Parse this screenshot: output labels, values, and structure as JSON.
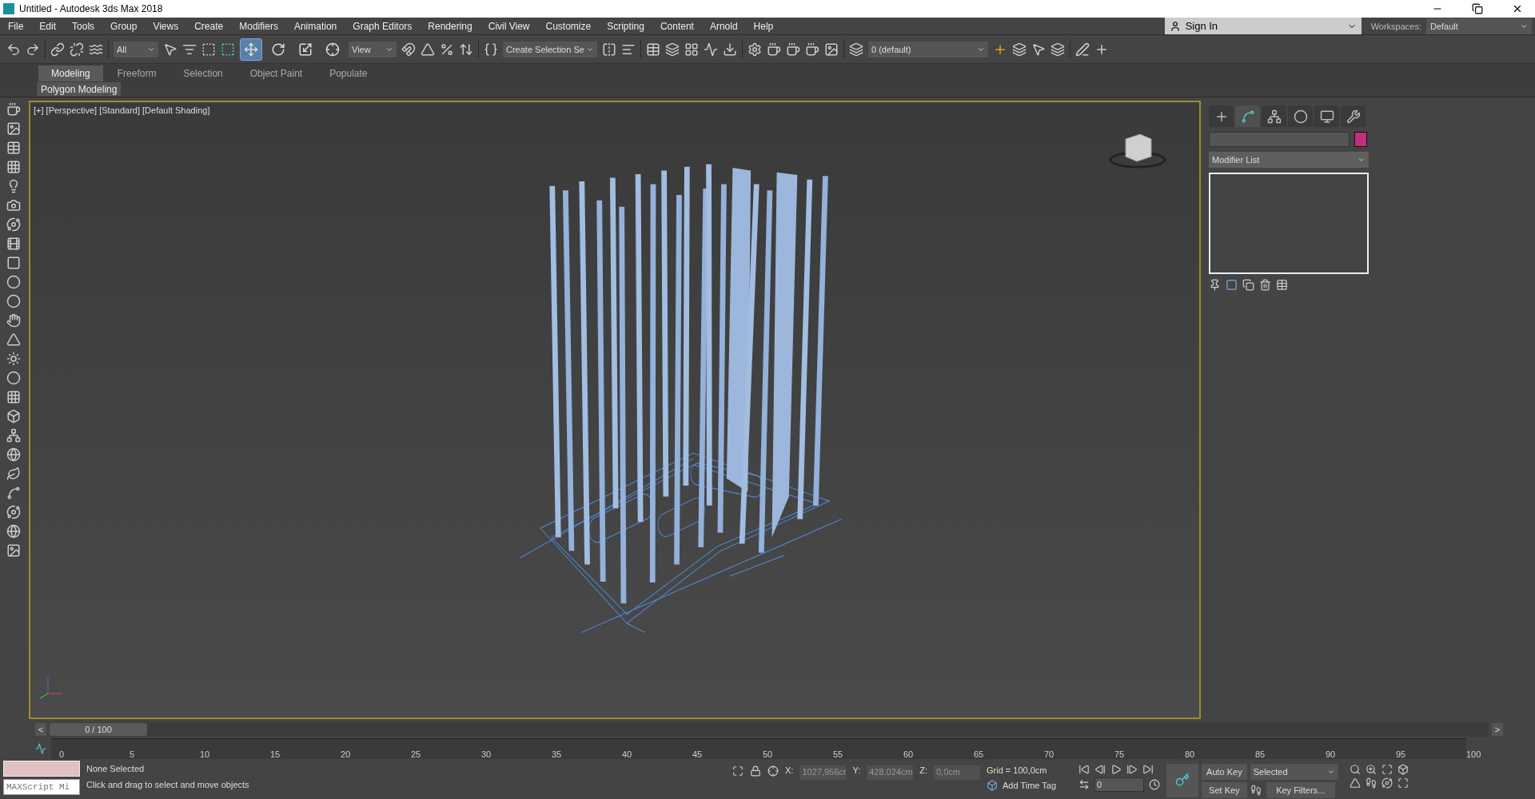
{
  "window": {
    "title": "Untitled - Autodesk 3ds Max 2018"
  },
  "menu": [
    "File",
    "Edit",
    "Tools",
    "Group",
    "Views",
    "Create",
    "Modifiers",
    "Animation",
    "Graph Editors",
    "Rendering",
    "Civil View",
    "Customize",
    "Scripting",
    "Content",
    "Arnold",
    "Help"
  ],
  "account": {
    "sign_in": "Sign In",
    "workspaces_label": "Workspaces:",
    "workspace": "Default"
  },
  "toolbar": {
    "selection_filter": "All",
    "reference_coord": "View",
    "selection_set": "Create Selection Se",
    "layer": "0 (default)"
  },
  "transform_tools": [
    {
      "kind": "move",
      "selected": true
    },
    {
      "kind": "rotate",
      "selected": false
    },
    {
      "kind": "scale",
      "selected": false
    },
    {
      "kind": "place",
      "selected": false
    }
  ],
  "ribbon": {
    "tabs": [
      {
        "label": "Modeling",
        "selected": true
      },
      {
        "label": "Freeform",
        "selected": false
      },
      {
        "label": "Selection",
        "selected": false
      },
      {
        "label": "Object Paint",
        "selected": false
      },
      {
        "label": "Populate",
        "selected": false
      }
    ],
    "panel": "Polygon Modeling"
  },
  "viewport": {
    "label": "[+] [Perspective] [Standard] [Default Shading]"
  },
  "command_panel": {
    "tabs": [
      {
        "kind": "create",
        "selected": false
      },
      {
        "kind": "modify",
        "selected": true
      },
      {
        "kind": "hierarchy",
        "selected": false
      },
      {
        "kind": "motion",
        "selected": false
      },
      {
        "kind": "display",
        "selected": false
      },
      {
        "kind": "utilities",
        "selected": false
      }
    ],
    "modifier_list": "Modifier List"
  },
  "timeline": {
    "prev": "<",
    "frame": "0 / 100",
    "next": ">",
    "ticks": [
      "0",
      "5",
      "10",
      "15",
      "20",
      "25",
      "30",
      "35",
      "40",
      "45",
      "50",
      "55",
      "60",
      "65",
      "70",
      "75",
      "80",
      "85",
      "90",
      "95",
      "100"
    ]
  },
  "status": {
    "selection": "None Selected",
    "maxscript_placeholder": "MAXScript Mi",
    "prompt": "Click and drag to select and move objects",
    "x_label": "X:",
    "x": "1027,956cr",
    "y_label": "Y:",
    "y": "428,024cm",
    "z_label": "Z:",
    "z": "0,0cm",
    "grid": "Grid = 100,0cm",
    "time_tag": "Add Time Tag"
  },
  "animation": {
    "auto_key": "Auto Key",
    "key_mode": "Selected",
    "set_key": "Set Key",
    "key_filters": "Key Filters...",
    "current_frame": "0"
  }
}
